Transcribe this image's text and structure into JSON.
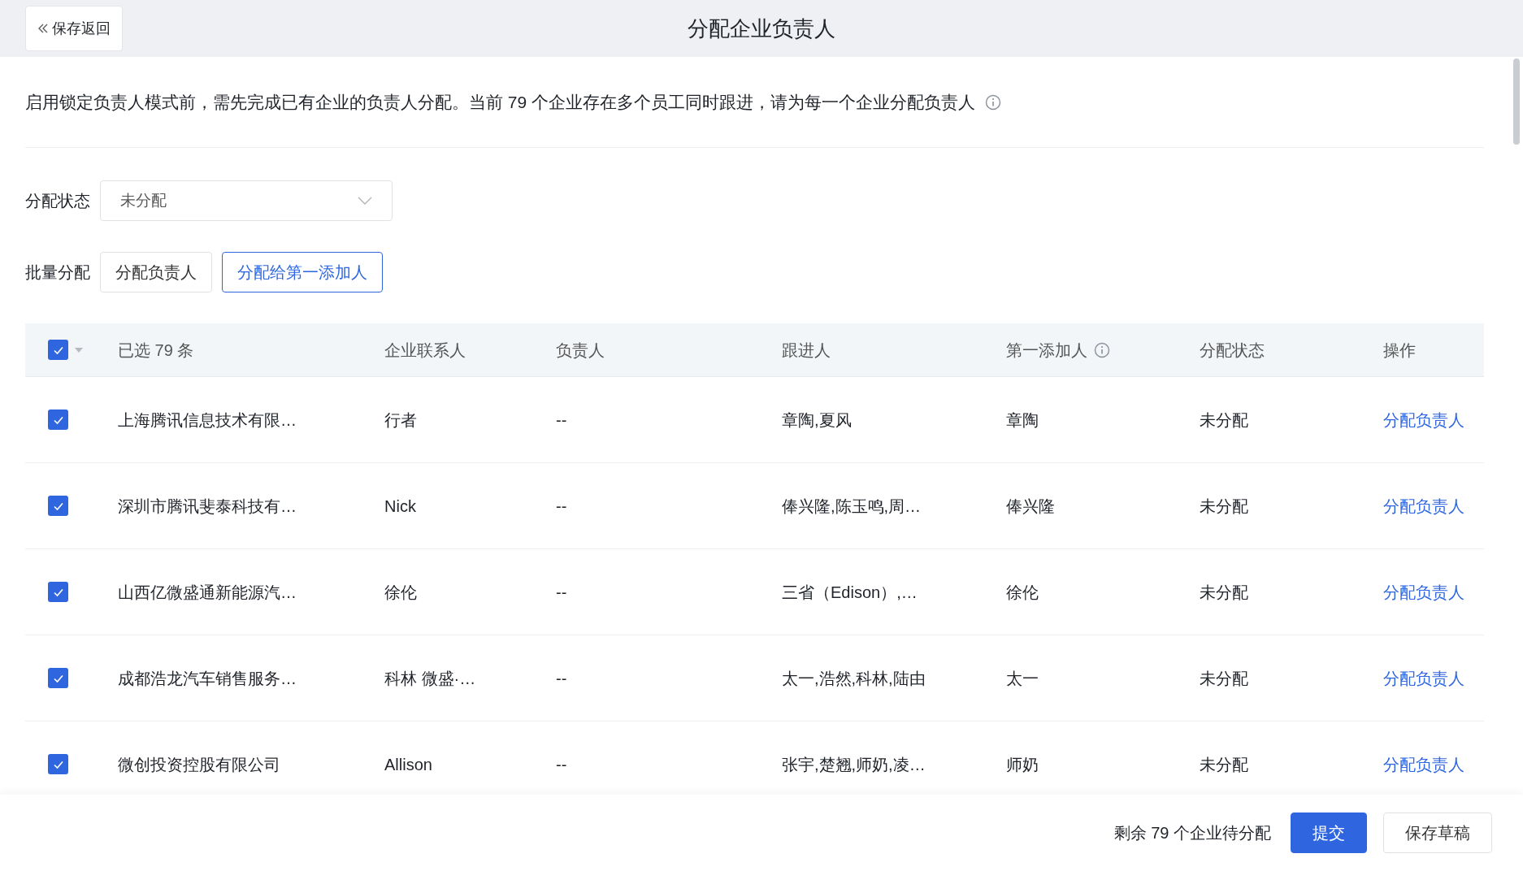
{
  "header": {
    "back_button": "保存返回",
    "title": "分配企业负责人"
  },
  "notice": "启用锁定负责人模式前，需先完成已有企业的负责人分配。当前 79 个企业存在多个员工同时跟进，请为每一个企业分配负责人",
  "filter": {
    "label": "分配状态",
    "value": "未分配"
  },
  "batch": {
    "label": "批量分配",
    "buttons": [
      {
        "label": "分配负责人",
        "selected": false
      },
      {
        "label": "分配给第一添加人",
        "selected": true
      }
    ]
  },
  "table": {
    "select_all": {
      "checked": true,
      "label": "已选 79 条"
    },
    "columns": [
      "企业联系人",
      "负责人",
      "跟进人",
      "第一添加人",
      "分配状态",
      "操作"
    ],
    "rows": [
      {
        "checked": true,
        "company": "上海腾讯信息技术有限…",
        "contact": "行者",
        "owner": "--",
        "followers": "章陶,夏风",
        "first_adder": "章陶",
        "status": "未分配",
        "action": "分配负责人"
      },
      {
        "checked": true,
        "company": "深圳市腾讯斐泰科技有…",
        "contact": "Nick",
        "owner": "--",
        "followers": "俸兴隆,陈玉鸣,周…",
        "first_adder": "俸兴隆",
        "status": "未分配",
        "action": "分配负责人"
      },
      {
        "checked": true,
        "company": "山西亿微盛通新能源汽…",
        "contact": "徐伦",
        "owner": "--",
        "followers": "三省（Edison）,…",
        "first_adder": "徐伦",
        "status": "未分配",
        "action": "分配负责人"
      },
      {
        "checked": true,
        "company": "成都浩龙汽车销售服务…",
        "contact": "科林 微盛·…",
        "owner": "--",
        "followers": "太一,浩然,科林,陆由",
        "first_adder": "太一",
        "status": "未分配",
        "action": "分配负责人"
      },
      {
        "checked": true,
        "company": "微创投资控股有限公司",
        "contact": "Allison",
        "owner": "--",
        "followers": "张宇,楚翘,师奶,凌…",
        "first_adder": "师奶",
        "status": "未分配",
        "action": "分配负责人"
      }
    ]
  },
  "footer": {
    "remaining": "剩余 79 个企业待分配",
    "buttons": [
      {
        "label": "提交",
        "kind": "primary"
      },
      {
        "label": "保存草稿",
        "kind": "secondary"
      }
    ]
  }
}
